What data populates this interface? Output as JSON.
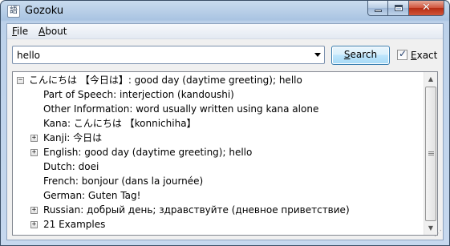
{
  "window": {
    "title": "Gozoku",
    "app_icon": "語"
  },
  "menu": [
    {
      "label": "File",
      "u": "F",
      "rest": "ile"
    },
    {
      "label": "About",
      "u": "A",
      "rest": "bout"
    }
  ],
  "search": {
    "value": "hello",
    "button_u": "S",
    "button_rest": "earch"
  },
  "exact": {
    "checked": true,
    "u": "E",
    "rest": "xact"
  },
  "tree": {
    "root": "こんにちは 【今日は】: good day (daytime greeting); hello",
    "children": [
      {
        "text": "Part of Speech: interjection (kandoushi)",
        "expandable": false
      },
      {
        "text": "Other Information: word usually written using kana alone",
        "expandable": false
      },
      {
        "text": "Kana: こんにちは 【konnichiha】",
        "expandable": false
      },
      {
        "text": "Kanji: 今日は",
        "expandable": true
      },
      {
        "text": "English: good day (daytime greeting); hello",
        "expandable": true
      },
      {
        "text": "Dutch: doei",
        "expandable": false
      },
      {
        "text": "French: bonjour (dans la journée)",
        "expandable": false
      },
      {
        "text": "German: Guten Tag!",
        "expandable": false
      },
      {
        "text": "Russian: добрый день; здравствуйте (дневное приветствие)",
        "expandable": true
      },
      {
        "text": "21 Examples",
        "expandable": true
      }
    ]
  },
  "glyphs": {
    "minus": "−",
    "plus": "+",
    "check": "✓",
    "close": "✕",
    "up": "▲",
    "down": "▼",
    "grip": "⋰"
  },
  "colors": {
    "titlebar": "#bcd1ea",
    "close_button": "#c9462c",
    "button_focus": "#3c7fb1"
  }
}
